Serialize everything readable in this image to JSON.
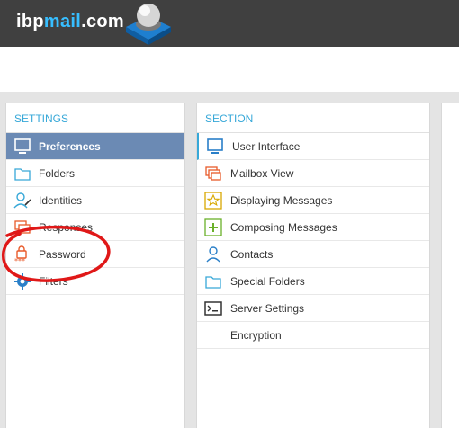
{
  "header": {
    "logo_prefix": "ibp",
    "logo_accent": "mail",
    "logo_suffix": ".com"
  },
  "settings": {
    "heading": "SETTINGS",
    "items": [
      {
        "label": "Preferences",
        "icon": "monitor-icon",
        "selected": true
      },
      {
        "label": "Folders",
        "icon": "folder-icon"
      },
      {
        "label": "Identities",
        "icon": "identity-icon"
      },
      {
        "label": "Responses",
        "icon": "responses-icon"
      },
      {
        "label": "Password",
        "icon": "lock-icon"
      },
      {
        "label": "Filters",
        "icon": "gear-icon"
      }
    ]
  },
  "section": {
    "heading": "SECTION",
    "items": [
      {
        "label": "User Interface",
        "icon": "monitor-icon"
      },
      {
        "label": "Mailbox View",
        "icon": "mailbox-icon"
      },
      {
        "label": "Displaying Messages",
        "icon": "star-icon"
      },
      {
        "label": "Composing Messages",
        "icon": "plus-icon"
      },
      {
        "label": "Contacts",
        "icon": "contact-icon"
      },
      {
        "label": "Special Folders",
        "icon": "folder-icon"
      },
      {
        "label": "Server Settings",
        "icon": "terminal-icon"
      },
      {
        "label": "Encryption",
        "icon": ""
      }
    ]
  },
  "colors": {
    "topbar": "#404040",
    "accent": "#37beff",
    "selected": "#6b8ab4",
    "heading": "#37a8d8",
    "annotation": "#e01818"
  }
}
